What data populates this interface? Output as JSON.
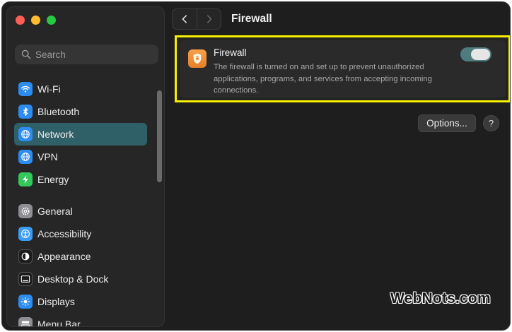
{
  "window": {
    "title": "Firewall"
  },
  "search": {
    "placeholder": "Search"
  },
  "sidebar": {
    "items": [
      {
        "label": "Wi-Fi",
        "icon": "wifi-icon"
      },
      {
        "label": "Bluetooth",
        "icon": "bluetooth-icon"
      },
      {
        "label": "Network",
        "icon": "globe-icon",
        "selected": true
      },
      {
        "label": "VPN",
        "icon": "vpn-globe-icon"
      },
      {
        "label": "Energy",
        "icon": "bolt-icon"
      },
      {
        "label": "General",
        "icon": "gear-icon"
      },
      {
        "label": "Accessibility",
        "icon": "accessibility-icon"
      },
      {
        "label": "Appearance",
        "icon": "appearance-icon"
      },
      {
        "label": "Desktop & Dock",
        "icon": "dock-icon"
      },
      {
        "label": "Displays",
        "icon": "sun-icon"
      },
      {
        "label": "Menu Bar",
        "icon": "menu-bar-icon"
      }
    ]
  },
  "firewall": {
    "title": "Firewall",
    "description": "The firewall is turned on and set up to prevent unauthorized applications, programs, and services from accepting incoming connections.",
    "enabled": true
  },
  "buttons": {
    "options": "Options...",
    "help": "?"
  },
  "watermark": "WebNots.com",
  "colors": {
    "accent_selected": "#2f5f67",
    "highlight_border": "#f5ef00",
    "toggle_on": "#4f7d7f"
  }
}
